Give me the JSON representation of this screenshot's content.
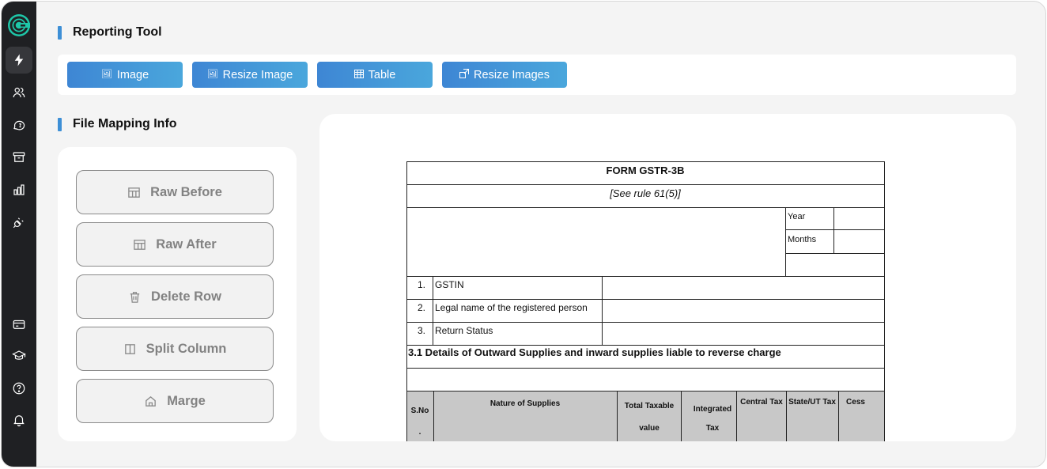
{
  "sidebar": {
    "logo": "app-logo",
    "top_items": [
      {
        "icon": "lightning-icon",
        "active": true
      },
      {
        "icon": "users-icon",
        "active": false
      },
      {
        "icon": "chat-icon",
        "active": false
      },
      {
        "icon": "archive-icon",
        "active": false
      },
      {
        "icon": "bar-chart-icon",
        "active": false
      },
      {
        "icon": "plug-icon",
        "active": false
      }
    ],
    "bottom_items": [
      {
        "icon": "card-icon"
      },
      {
        "icon": "graduation-cap-icon"
      },
      {
        "icon": "help-icon"
      },
      {
        "icon": "bell-icon"
      }
    ]
  },
  "reporting": {
    "title": "Reporting Tool",
    "buttons": [
      {
        "label": "Image",
        "icon": "image-icon"
      },
      {
        "label": "Resize Image",
        "icon": "image-icon"
      },
      {
        "label": "Table",
        "icon": "table-icon"
      },
      {
        "label": "Resize Images",
        "icon": "resize-icon"
      }
    ]
  },
  "mapping": {
    "title": "File Mapping Info",
    "actions": [
      {
        "label": "Raw Before",
        "icon": "table-icon"
      },
      {
        "label": "Raw After",
        "icon": "table-icon"
      },
      {
        "label": "Delete Row",
        "icon": "trash-icon"
      },
      {
        "label": "Split Column",
        "icon": "split-column-icon"
      },
      {
        "label": "Marge",
        "icon": "merge-icon"
      }
    ]
  },
  "document": {
    "title": "FORM GSTR-3B",
    "rule": "[See rule 61(5)]",
    "year_label": "Year",
    "months_label": "Months",
    "rows": [
      {
        "num": "1.",
        "label": "GSTIN"
      },
      {
        "num": "2.",
        "label": "Legal name of the registered person"
      },
      {
        "num": "3.",
        "label": "Return Status"
      }
    ],
    "section_title": "3.1 Details of Outward Supplies and inward supplies liable to reverse charge",
    "table_headers": {
      "sno_line1": "S.No",
      "sno_line2": ".",
      "nature": "Nature of Supplies",
      "taxable_line1": "Total Taxable",
      "taxable_line2": "value",
      "integrated_line1": "Integrated",
      "integrated_line2": "Tax",
      "central": "Central Tax",
      "state": "State/UT Tax",
      "cess": "Cess"
    }
  }
}
